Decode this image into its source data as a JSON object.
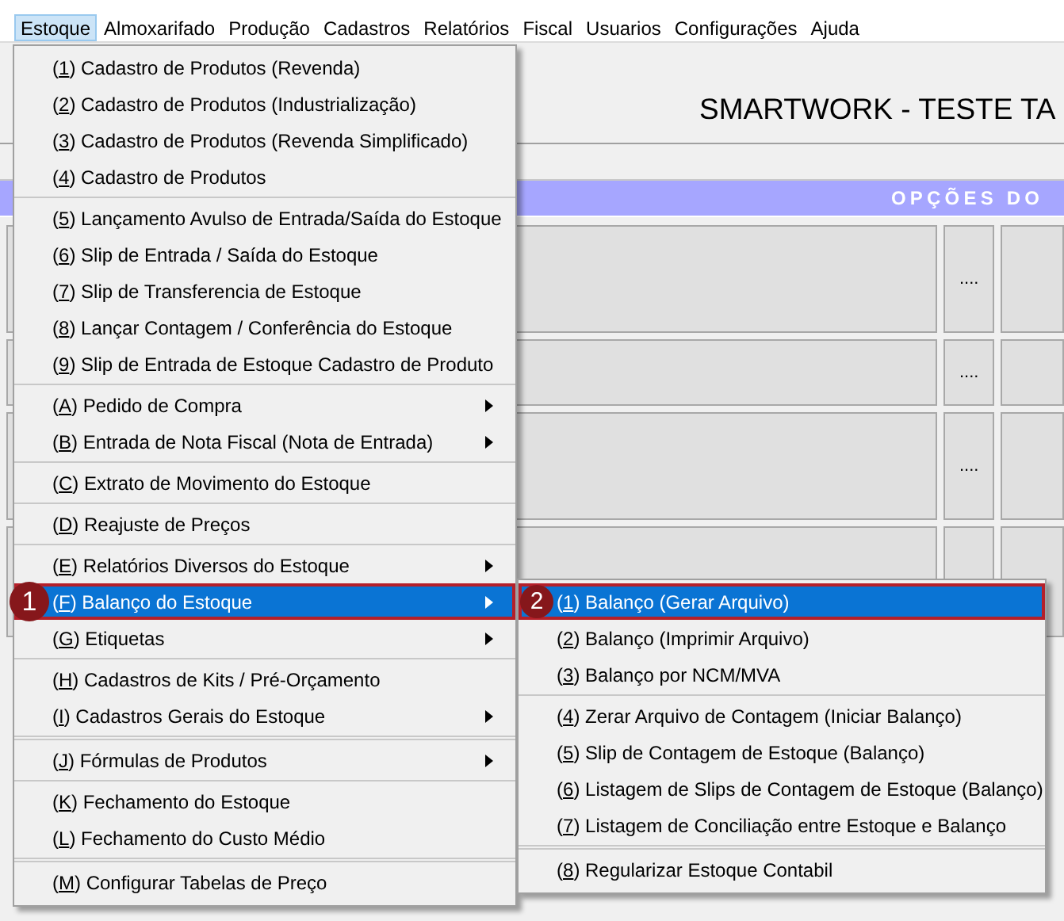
{
  "menubar": [
    {
      "label": "Estoque",
      "selected": true
    },
    {
      "label": "Almoxarifado",
      "selected": false
    },
    {
      "label": "Produção",
      "selected": false
    },
    {
      "label": "Cadastros",
      "selected": false
    },
    {
      "label": "Relatórios",
      "selected": false
    },
    {
      "label": "Fiscal",
      "selected": false
    },
    {
      "label": "Usuarios",
      "selected": false
    },
    {
      "label": "Configurações",
      "selected": false
    },
    {
      "label": "Ajuda",
      "selected": false
    }
  ],
  "header": {
    "title": "SMARTWORK - TESTE TA"
  },
  "options_bar": {
    "label": "OPÇÕES DO"
  },
  "panel_rows": [
    {
      "button": "...."
    },
    {
      "button": "...."
    },
    {
      "button": "...."
    },
    {}
  ],
  "menu": {
    "groups": [
      {
        "items": [
          {
            "label": "(1) Cadastro de Produtos (Revenda)",
            "selected": false,
            "submenu": false
          },
          {
            "label": "(2) Cadastro de Produtos (Industrialização)",
            "selected": false,
            "submenu": false
          },
          {
            "label": "(3) Cadastro de Produtos (Revenda Simplificado)",
            "selected": false,
            "submenu": false
          },
          {
            "label": "(4) Cadastro de Produtos",
            "selected": false,
            "submenu": false
          }
        ]
      },
      {
        "items": [
          {
            "label": "(5) Lançamento Avulso de Entrada/Saída do Estoque",
            "selected": false,
            "submenu": false
          },
          {
            "label": "(6) Slip de Entrada / Saída do Estoque",
            "selected": false,
            "submenu": false
          },
          {
            "label": "(7) Slip de Transferencia de Estoque",
            "selected": false,
            "submenu": false
          },
          {
            "label": "(8) Lançar Contagem / Conferência do Estoque",
            "selected": false,
            "submenu": false
          },
          {
            "label": "(9) Slip de Entrada de Estoque Cadastro de Produto",
            "selected": false,
            "submenu": false
          }
        ]
      },
      {
        "items": [
          {
            "label": "(A) Pedido de Compra",
            "selected": false,
            "submenu": true
          },
          {
            "label": "(B) Entrada de Nota Fiscal (Nota de Entrada)",
            "selected": false,
            "submenu": true
          }
        ]
      },
      {
        "items": [
          {
            "label": "(C) Extrato de Movimento do Estoque",
            "selected": false,
            "submenu": false
          }
        ]
      },
      {
        "items": [
          {
            "label": "(D) Reajuste de Preços",
            "selected": false,
            "submenu": false
          }
        ]
      },
      {
        "items": [
          {
            "label": "(E) Relatórios Diversos do Estoque",
            "selected": false,
            "submenu": true
          },
          {
            "label": "(F) Balanço do Estoque",
            "selected": true,
            "submenu": true,
            "callout": "1"
          },
          {
            "label": "(G) Etiquetas",
            "selected": false,
            "submenu": true
          }
        ]
      },
      {
        "items": [
          {
            "label": "(H) Cadastros de Kits / Pré-Orçamento",
            "selected": false,
            "submenu": false
          },
          {
            "label": "(I) Cadastros Gerais do Estoque",
            "selected": false,
            "submenu": true
          }
        ]
      },
      {
        "items": [
          {
            "label": "(J) Fórmulas de Produtos",
            "selected": false,
            "submenu": true
          }
        ]
      },
      {
        "items": [
          {
            "label": "(K) Fechamento do Estoque",
            "selected": false,
            "submenu": false
          },
          {
            "label": "(L) Fechamento do Custo Médio",
            "selected": false,
            "submenu": false
          }
        ]
      },
      {
        "items": [
          {
            "label": "(M) Configurar Tabelas de Preço",
            "selected": false,
            "submenu": false
          }
        ]
      }
    ]
  },
  "submenu": {
    "groups": [
      {
        "items": [
          {
            "label": "(1) Balanço (Gerar Arquivo)",
            "selected": true,
            "submenu": false,
            "callout": "2"
          },
          {
            "label": "(2) Balanço (Imprimir Arquivo)",
            "selected": false,
            "submenu": false
          },
          {
            "label": "(3) Balanço por NCM/MVA",
            "selected": false,
            "submenu": false
          }
        ]
      },
      {
        "items": [
          {
            "label": "(4) Zerar Arquivo de Contagem (Iniciar Balanço)",
            "selected": false,
            "submenu": false
          },
          {
            "label": "(5) Slip de Contagem de Estoque (Balanço)",
            "selected": false,
            "submenu": false
          },
          {
            "label": "(6) Listagem de Slips de Contagem de Estoque (Balanço)",
            "selected": false,
            "submenu": false
          },
          {
            "label": "(7) Listagem de Conciliação entre Estoque e Balanço",
            "selected": false,
            "submenu": false
          }
        ]
      },
      {
        "items": [
          {
            "label": "(8) Regularizar Estoque Contabil",
            "selected": false,
            "submenu": false
          }
        ]
      }
    ]
  }
}
